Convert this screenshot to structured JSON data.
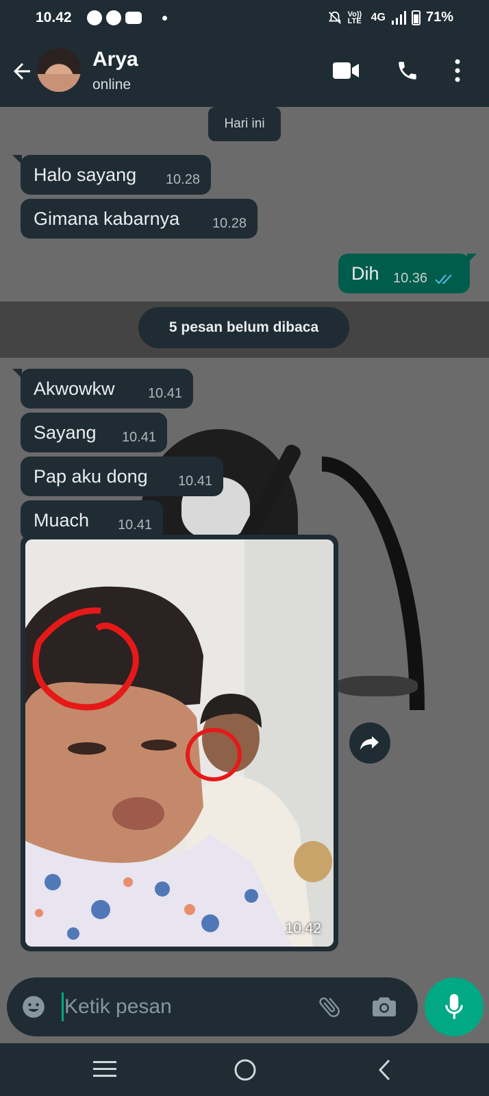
{
  "status_bar": {
    "time": "10.42",
    "network": "4G",
    "battery": "71%",
    "volte": "Vo)) LTE"
  },
  "header": {
    "contact_name": "Arya",
    "contact_status": "online"
  },
  "chat": {
    "date_label": "Hari ini",
    "messages": [
      {
        "text": "Halo sayang",
        "time": "10.28"
      },
      {
        "text": "Gimana kabarnya",
        "time": "10.28"
      },
      {
        "text": "Dih",
        "time": "10.36"
      },
      {
        "text": "Akwowkw",
        "time": "10.41"
      },
      {
        "text": "Sayang",
        "time": "10.41"
      },
      {
        "text": "Pap aku dong",
        "time": "10.41"
      },
      {
        "text": "Muach",
        "time": "10.41"
      }
    ],
    "unread_label": "5 pesan belum dibaca",
    "image_time": "10.42"
  },
  "input": {
    "placeholder": "Ketik pesan"
  },
  "colors": {
    "header_bg": "#1f2c33",
    "bubble_in": "#1f2c33",
    "bubble_out": "#005c4b",
    "accent": "#00a884",
    "read_ticks": "#53bdeb"
  }
}
